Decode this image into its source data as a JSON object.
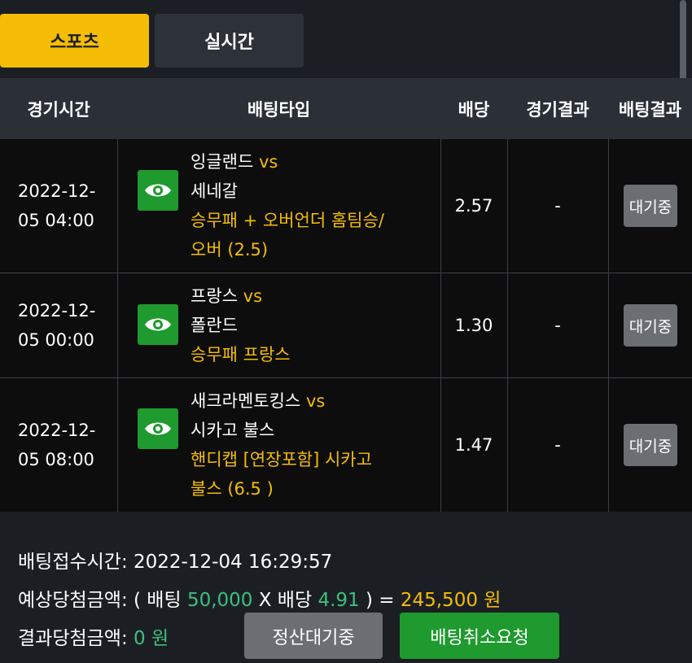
{
  "tabs": {
    "sports": "스포츠",
    "live": "실시간"
  },
  "headers": {
    "time": "경기시간",
    "bet_type": "배팅타입",
    "odds": "배당",
    "game_result": "경기결과",
    "bet_result": "배팅결과"
  },
  "rows": [
    {
      "date": "2022-12-",
      "time": "05 04:00",
      "home": "잉글랜드",
      "vs": "vs",
      "away": "세네갈",
      "bet_line1": "승무패 + 오버언더 홈팀승/",
      "bet_line2": "오버 (2.5)",
      "odds": "2.57",
      "result": "-",
      "status": "대기중"
    },
    {
      "date": "2022-12-",
      "time": "05 00:00",
      "home": "프랑스",
      "vs": "vs",
      "away": "폴란드",
      "bet_line1": "승무패 프랑스",
      "bet_line2": "",
      "odds": "1.30",
      "result": "-",
      "status": "대기중"
    },
    {
      "date": "2022-12-",
      "time": "05 08:00",
      "home": "새크라멘토킹스",
      "vs": "vs",
      "away": "시카고 불스",
      "bet_line1": "핸디캡 [연장포함] 시카고",
      "bet_line2": "불스 (6.5 )",
      "odds": "1.47",
      "result": "-",
      "status": "대기중"
    }
  ],
  "footer": {
    "received_label": "배팅접수시간: 2022-12-04 16:29:57",
    "expected_prefix": "예상당첨금액: ( 배팅 ",
    "stake": "50,000",
    "times_odds": " X 배당 ",
    "total_odds": "4.91",
    "equals": " ) = ",
    "expected_amount": "245,500 원",
    "result_prefix": "결과당첨금액: ",
    "result_amount": "0 원",
    "settle_wait_button": "정산대기중",
    "cancel_request_button": "배팅취소요청"
  },
  "colors": {
    "accent": "#f5bd05",
    "green_button": "#1e9a2e",
    "green_text": "#3fbf7f",
    "status_gray": "#6b6e73"
  }
}
